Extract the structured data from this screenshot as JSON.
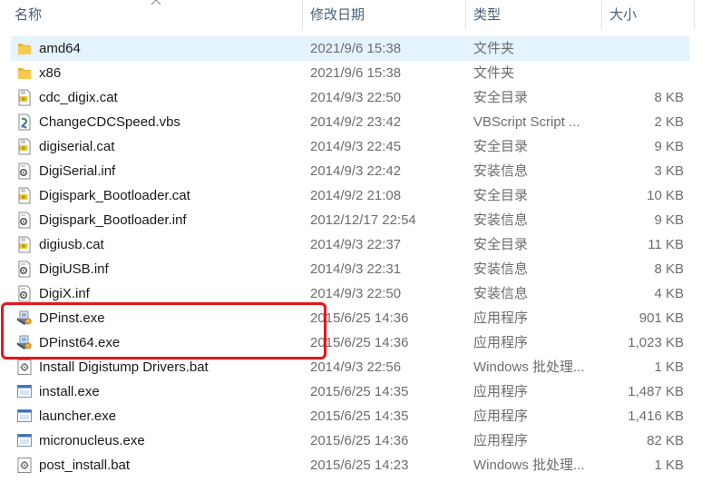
{
  "header": {
    "name": "名称",
    "date": "修改日期",
    "type": "类型",
    "size": "大小"
  },
  "files": [
    {
      "name": "amd64",
      "date": "2021/9/6 15:38",
      "type": "文件夹",
      "size": "",
      "icon": "folder-icon",
      "selected": true
    },
    {
      "name": "x86",
      "date": "2021/9/6 15:38",
      "type": "文件夹",
      "size": "",
      "icon": "folder-icon"
    },
    {
      "name": "cdc_digix.cat",
      "date": "2014/9/3 22:50",
      "type": "安全目录",
      "size": "8 KB",
      "icon": "security-catalog-icon"
    },
    {
      "name": "ChangeCDCSpeed.vbs",
      "date": "2014/9/2 23:42",
      "type": "VBScript Script ...",
      "size": "2 KB",
      "icon": "vbscript-icon"
    },
    {
      "name": "digiserial.cat",
      "date": "2014/9/3 22:45",
      "type": "安全目录",
      "size": "9 KB",
      "icon": "security-catalog-icon"
    },
    {
      "name": "DigiSerial.inf",
      "date": "2014/9/3 22:42",
      "type": "安装信息",
      "size": "3 KB",
      "icon": "setup-info-icon"
    },
    {
      "name": "Digispark_Bootloader.cat",
      "date": "2014/9/2 21:08",
      "type": "安全目录",
      "size": "10 KB",
      "icon": "security-catalog-icon"
    },
    {
      "name": "Digispark_Bootloader.inf",
      "date": "2012/12/17 22:54",
      "type": "安装信息",
      "size": "9 KB",
      "icon": "setup-info-icon"
    },
    {
      "name": "digiusb.cat",
      "date": "2014/9/3 22:37",
      "type": "安全目录",
      "size": "11 KB",
      "icon": "security-catalog-icon"
    },
    {
      "name": "DigiUSB.inf",
      "date": "2014/9/3 22:31",
      "type": "安装信息",
      "size": "8 KB",
      "icon": "setup-info-icon"
    },
    {
      "name": "DigiX.inf",
      "date": "2014/9/3 22:50",
      "type": "安装信息",
      "size": "4 KB",
      "icon": "setup-info-icon"
    },
    {
      "name": "DPinst.exe",
      "date": "2015/6/25 14:36",
      "type": "应用程序",
      "size": "901 KB",
      "icon": "installer-exe-icon"
    },
    {
      "name": "DPinst64.exe",
      "date": "2015/6/25 14:36",
      "type": "应用程序",
      "size": "1,023 KB",
      "icon": "installer-exe-icon"
    },
    {
      "name": "Install Digistump Drivers.bat",
      "date": "2014/9/3 22:56",
      "type": "Windows 批处理...",
      "size": "1 KB",
      "icon": "batch-file-icon"
    },
    {
      "name": "install.exe",
      "date": "2015/6/25 14:35",
      "type": "应用程序",
      "size": "1,487 KB",
      "icon": "app-exe-icon"
    },
    {
      "name": "launcher.exe",
      "date": "2015/6/25 14:35",
      "type": "应用程序",
      "size": "1,416 KB",
      "icon": "app-exe-icon"
    },
    {
      "name": "micronucleus.exe",
      "date": "2015/6/25 14:36",
      "type": "应用程序",
      "size": "82 KB",
      "icon": "app-exe-icon"
    },
    {
      "name": "post_install.bat",
      "date": "2015/6/25 14:23",
      "type": "Windows 批处理...",
      "size": "1 KB",
      "icon": "batch-file-icon"
    }
  ],
  "colors": {
    "highlight": "#e8141c",
    "selected_row": "#e5f3ff",
    "header_text": "#4c607a",
    "folder": "#f4c44e"
  }
}
